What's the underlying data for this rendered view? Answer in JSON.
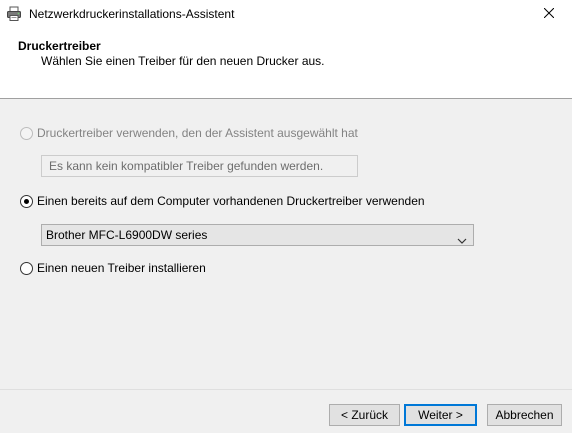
{
  "window": {
    "title": "Netzwerkdruckerinstallations-Assistent",
    "icon": "printer-icon",
    "close_icon": "close-icon"
  },
  "header": {
    "title": "Druckertreiber",
    "subtitle": "Wählen Sie einen Treiber für den neuen Drucker aus."
  },
  "options": {
    "wizard_driver": {
      "label": "Druckertreiber verwenden, den der Assistent ausgewählt hat",
      "selected": false,
      "enabled": false,
      "info_text": "Es kann kein kompatibler Treiber gefunden werden."
    },
    "existing_driver": {
      "label": "Einen bereits auf dem Computer vorhandenen Druckertreiber verwenden",
      "selected": true,
      "enabled": true,
      "dropdown_value": "Brother MFC-L6900DW series"
    },
    "new_driver": {
      "label": "Einen neuen Treiber installieren",
      "selected": false,
      "enabled": true
    }
  },
  "footer": {
    "back_label": "< Zurück",
    "next_label": "Weiter >",
    "cancel_label": "Abbrechen"
  },
  "colors": {
    "accent": "#0078d7",
    "content_bg": "#f0f0f0",
    "header_bg": "#ffffff"
  }
}
